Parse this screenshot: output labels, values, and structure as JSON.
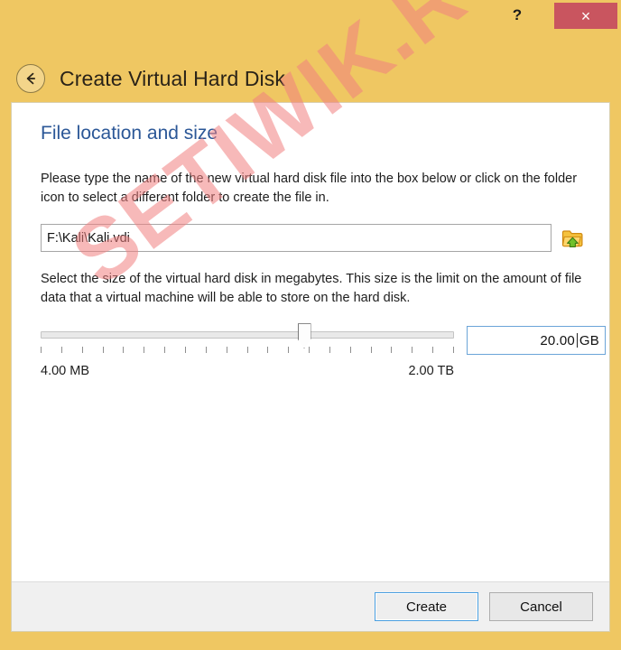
{
  "window": {
    "title": "Create Virtual Hard Disk",
    "titlebar_color": "#efc762",
    "close_button_color": "#c9555f",
    "help_label": "?",
    "close_label": "×",
    "back_icon": "back-arrow-icon"
  },
  "page": {
    "heading": "File location and size",
    "heading_color": "#2b5797",
    "paragraph_location": "Please type the name of the new virtual hard disk file into the box below or click on the folder icon to select a different folder to create the file in.",
    "paragraph_size": "Select the size of the virtual hard disk in megabytes. This size is the limit on the amount of file data that a virtual machine will be able to store on the hard disk."
  },
  "file_location": {
    "path_value": "F:\\Kali\\Kali.vdi",
    "path_placeholder": "",
    "folder_icon": "folder-open-icon"
  },
  "size": {
    "value": "20.00",
    "unit": "GB",
    "min_label": "4.00 MB",
    "max_label": "2.00 TB",
    "slider_tick_count": 21,
    "slider_thumb_position_pct": 64,
    "input_border_color": "#6ba4d8"
  },
  "footer": {
    "create_label": "Create",
    "cancel_label": "Cancel"
  },
  "watermark": {
    "text": "SETIWIK.RU",
    "color": "#f08080"
  }
}
